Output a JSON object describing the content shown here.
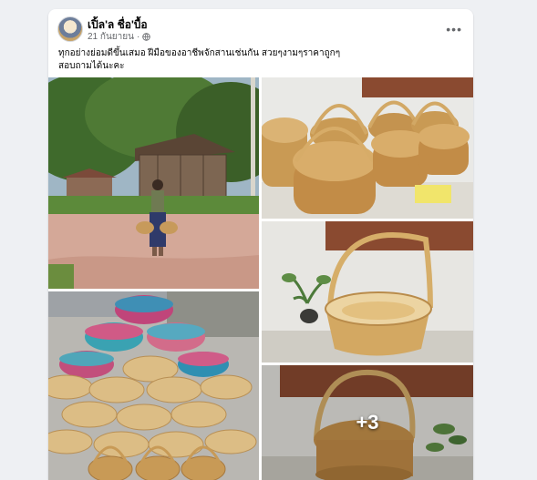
{
  "post": {
    "author": "เปิ้ล'ล ชื่อ'บื้อ",
    "date": "21 กันยายน",
    "separator": "·",
    "privacy_icon": "globe-icon",
    "more_icon": "more-options-icon",
    "more_label": "•••",
    "caption_line1": "ทุกอย่างย่อมดีขึ้นเสมอ ฝีมือของอาชีพจักสานเช่นกัน สวยๆงามๆราคาถูกๆ",
    "caption_line2": "สอบถามได้นะคะ"
  },
  "photos": {
    "count_more": "+3"
  },
  "colors": {
    "card_bg": "#ffffff",
    "page_bg": "#eef0f3",
    "text_primary": "#050505",
    "text_secondary": "#65676b"
  }
}
